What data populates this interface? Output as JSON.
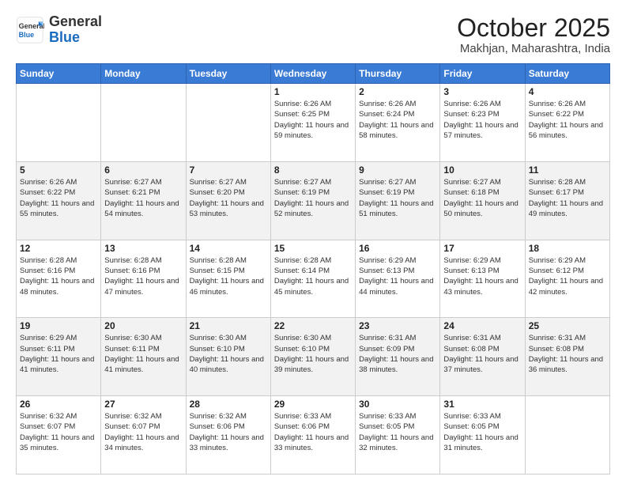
{
  "header": {
    "logo": {
      "general": "General",
      "blue": "Blue"
    },
    "month": "October 2025",
    "location": "Makhjan, Maharashtra, India"
  },
  "weekdays": [
    "Sunday",
    "Monday",
    "Tuesday",
    "Wednesday",
    "Thursday",
    "Friday",
    "Saturday"
  ],
  "weeks": [
    [
      {
        "day": "",
        "info": ""
      },
      {
        "day": "",
        "info": ""
      },
      {
        "day": "",
        "info": ""
      },
      {
        "day": "1",
        "info": "Sunrise: 6:26 AM\nSunset: 6:25 PM\nDaylight: 11 hours and 59 minutes."
      },
      {
        "day": "2",
        "info": "Sunrise: 6:26 AM\nSunset: 6:24 PM\nDaylight: 11 hours and 58 minutes."
      },
      {
        "day": "3",
        "info": "Sunrise: 6:26 AM\nSunset: 6:23 PM\nDaylight: 11 hours and 57 minutes."
      },
      {
        "day": "4",
        "info": "Sunrise: 6:26 AM\nSunset: 6:22 PM\nDaylight: 11 hours and 56 minutes."
      }
    ],
    [
      {
        "day": "5",
        "info": "Sunrise: 6:26 AM\nSunset: 6:22 PM\nDaylight: 11 hours and 55 minutes."
      },
      {
        "day": "6",
        "info": "Sunrise: 6:27 AM\nSunset: 6:21 PM\nDaylight: 11 hours and 54 minutes."
      },
      {
        "day": "7",
        "info": "Sunrise: 6:27 AM\nSunset: 6:20 PM\nDaylight: 11 hours and 53 minutes."
      },
      {
        "day": "8",
        "info": "Sunrise: 6:27 AM\nSunset: 6:19 PM\nDaylight: 11 hours and 52 minutes."
      },
      {
        "day": "9",
        "info": "Sunrise: 6:27 AM\nSunset: 6:19 PM\nDaylight: 11 hours and 51 minutes."
      },
      {
        "day": "10",
        "info": "Sunrise: 6:27 AM\nSunset: 6:18 PM\nDaylight: 11 hours and 50 minutes."
      },
      {
        "day": "11",
        "info": "Sunrise: 6:28 AM\nSunset: 6:17 PM\nDaylight: 11 hours and 49 minutes."
      }
    ],
    [
      {
        "day": "12",
        "info": "Sunrise: 6:28 AM\nSunset: 6:16 PM\nDaylight: 11 hours and 48 minutes."
      },
      {
        "day": "13",
        "info": "Sunrise: 6:28 AM\nSunset: 6:16 PM\nDaylight: 11 hours and 47 minutes."
      },
      {
        "day": "14",
        "info": "Sunrise: 6:28 AM\nSunset: 6:15 PM\nDaylight: 11 hours and 46 minutes."
      },
      {
        "day": "15",
        "info": "Sunrise: 6:28 AM\nSunset: 6:14 PM\nDaylight: 11 hours and 45 minutes."
      },
      {
        "day": "16",
        "info": "Sunrise: 6:29 AM\nSunset: 6:13 PM\nDaylight: 11 hours and 44 minutes."
      },
      {
        "day": "17",
        "info": "Sunrise: 6:29 AM\nSunset: 6:13 PM\nDaylight: 11 hours and 43 minutes."
      },
      {
        "day": "18",
        "info": "Sunrise: 6:29 AM\nSunset: 6:12 PM\nDaylight: 11 hours and 42 minutes."
      }
    ],
    [
      {
        "day": "19",
        "info": "Sunrise: 6:29 AM\nSunset: 6:11 PM\nDaylight: 11 hours and 41 minutes."
      },
      {
        "day": "20",
        "info": "Sunrise: 6:30 AM\nSunset: 6:11 PM\nDaylight: 11 hours and 41 minutes."
      },
      {
        "day": "21",
        "info": "Sunrise: 6:30 AM\nSunset: 6:10 PM\nDaylight: 11 hours and 40 minutes."
      },
      {
        "day": "22",
        "info": "Sunrise: 6:30 AM\nSunset: 6:10 PM\nDaylight: 11 hours and 39 minutes."
      },
      {
        "day": "23",
        "info": "Sunrise: 6:31 AM\nSunset: 6:09 PM\nDaylight: 11 hours and 38 minutes."
      },
      {
        "day": "24",
        "info": "Sunrise: 6:31 AM\nSunset: 6:08 PM\nDaylight: 11 hours and 37 minutes."
      },
      {
        "day": "25",
        "info": "Sunrise: 6:31 AM\nSunset: 6:08 PM\nDaylight: 11 hours and 36 minutes."
      }
    ],
    [
      {
        "day": "26",
        "info": "Sunrise: 6:32 AM\nSunset: 6:07 PM\nDaylight: 11 hours and 35 minutes."
      },
      {
        "day": "27",
        "info": "Sunrise: 6:32 AM\nSunset: 6:07 PM\nDaylight: 11 hours and 34 minutes."
      },
      {
        "day": "28",
        "info": "Sunrise: 6:32 AM\nSunset: 6:06 PM\nDaylight: 11 hours and 33 minutes."
      },
      {
        "day": "29",
        "info": "Sunrise: 6:33 AM\nSunset: 6:06 PM\nDaylight: 11 hours and 33 minutes."
      },
      {
        "day": "30",
        "info": "Sunrise: 6:33 AM\nSunset: 6:05 PM\nDaylight: 11 hours and 32 minutes."
      },
      {
        "day": "31",
        "info": "Sunrise: 6:33 AM\nSunset: 6:05 PM\nDaylight: 11 hours and 31 minutes."
      },
      {
        "day": "",
        "info": ""
      }
    ]
  ]
}
